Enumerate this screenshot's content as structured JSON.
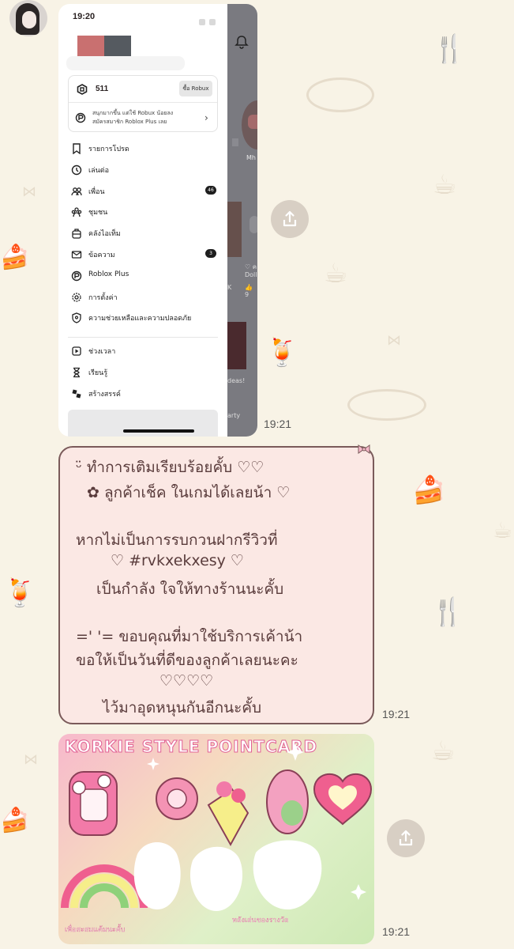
{
  "chat": {
    "screenshot_time": "19:21",
    "message_time": "19:21",
    "image_time": "19:21"
  },
  "roblox": {
    "status_time": "19:20",
    "robux_amount": "511",
    "buy_robux_label": "ซื้อ Robux",
    "plus_promo_line1": "สนุกมากขึ้น แต่ใช้ Robux น้อยลง",
    "plus_promo_line2": "สมัครสมาชิก Roblox Plus เลย",
    "menu": [
      {
        "label": "รายการโปรด",
        "icon": "bookmark-icon"
      },
      {
        "label": "เล่นต่อ",
        "icon": "history-icon"
      },
      {
        "label": "เพื่อน",
        "icon": "friends-icon",
        "badge": "46"
      },
      {
        "label": "ชุมชน",
        "icon": "community-icon"
      },
      {
        "label": "คลังไอเท็ม",
        "icon": "inventory-icon"
      },
      {
        "label": "ข้อความ",
        "icon": "mail-icon",
        "badge": "3"
      },
      {
        "label": "Roblox Plus",
        "icon": "roblox-plus-icon"
      },
      {
        "label": "การตั้งค่า",
        "icon": "gear-icon"
      },
      {
        "label": "ความช่วยเหลือและความปลอดภัย",
        "icon": "shield-icon"
      }
    ],
    "menu2": [
      {
        "label": "ช่วงเวลา",
        "icon": "play-icon"
      },
      {
        "label": "เรียนรู้",
        "icon": "hourglass-icon"
      },
      {
        "label": "สร้างสรรค์",
        "icon": "studio-icon"
      }
    ],
    "behind_text": {
      "mh": "Mh",
      "dolle": "♡ ค Dolle",
      "k": "K",
      "likes": "👍 9",
      "ideas": "deas!",
      "party": "arty"
    }
  },
  "message": {
    "lines": [
      "ᵕ̈  ทำการเติมเรียบร้อยคั้บ ♡♡",
      "✿ ลูกค้าเช็ค ในเกมได้เลยน้า ♡",
      "หากไม่เป็นการรบกวนฝากรีวิวที่",
      "♡  #rvkxekxesy  ♡",
      "เป็นกำลัง ใจให้ทางร้านนะคั้บ",
      "=' '= ขอบคุณที่มาใช้บริการเค้าน้า",
      "ขอให้เป็นวันที่ดีของลูกค้าเลยนะคะ",
      "♡♡♡♡",
      "ไว้มาอุดหนุนกันอีกนะคั้บ"
    ]
  },
  "card": {
    "title": "KORKIE STYLE POINTCARD",
    "footer_left": "เพื่อสะสมแต้มนะคั้บ",
    "footer_right": "หลังเล่นของรางวัล"
  },
  "colors": {
    "background": "#f8f3e6",
    "bubble": "#fbe8e4",
    "bubble_border": "#7a5a5a",
    "message_text": "#5a3c3c",
    "card_pink": "#e15f93"
  }
}
